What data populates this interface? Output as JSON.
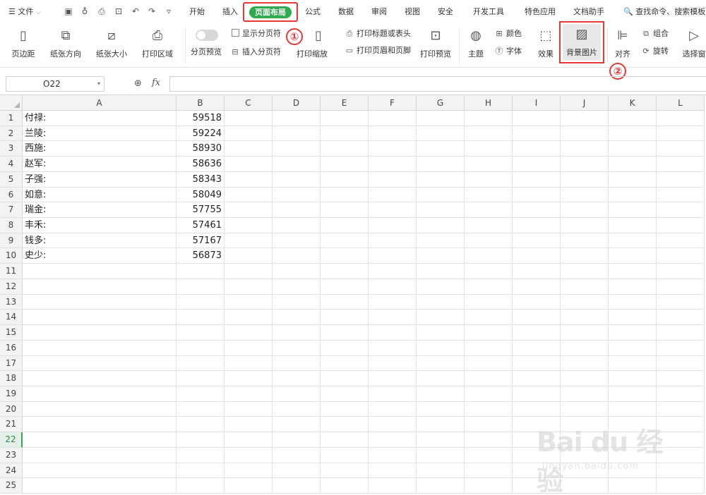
{
  "menubar": {
    "file_label": "文件",
    "tabs": [
      "开始",
      "插入",
      "页面布局",
      "公式",
      "数据",
      "审阅",
      "视图",
      "安全",
      "开发工具",
      "特色应用",
      "文档助手"
    ],
    "active_tab": "页面布局",
    "search_placeholder": "查找命令、搜索模板"
  },
  "ribbon": {
    "margins": "页边距",
    "orientation": "纸张方向",
    "size": "纸张大小",
    "print_area": "打印区域",
    "page_break_preview": "分页预览",
    "show_page_breaks": "显示分页符",
    "insert_page_break": "插入分页符",
    "print_scaling": "打印缩放",
    "print_titles": "打印标题或表头",
    "print_header_footer": "打印页眉和页脚",
    "print_preview": "打印预览",
    "theme": "主题",
    "colors": "颜色",
    "fonts": "字体",
    "effects": "效果",
    "background_picture": "背景图片",
    "align": "对齐",
    "group": "组合",
    "rotate": "旋转",
    "selection_pane": "选择窗"
  },
  "annotations": {
    "step1": "①",
    "step2": "②"
  },
  "formula_bar": {
    "name_box": "O22",
    "fx": "fx",
    "formula": ""
  },
  "columns": [
    "A",
    "B",
    "C",
    "D",
    "E",
    "F",
    "G",
    "H",
    "I",
    "J",
    "K",
    "L"
  ],
  "rows": [
    {
      "n": "1",
      "a": "付禄:",
      "b": "59518"
    },
    {
      "n": "2",
      "a": "兰陵:",
      "b": "59224"
    },
    {
      "n": "3",
      "a": "西施:",
      "b": "58930"
    },
    {
      "n": "4",
      "a": "赵军:",
      "b": "58636"
    },
    {
      "n": "5",
      "a": "子强:",
      "b": "58343"
    },
    {
      "n": "6",
      "a": "如意:",
      "b": "58049"
    },
    {
      "n": "7",
      "a": "瑞金:",
      "b": "57755"
    },
    {
      "n": "8",
      "a": "丰禾:",
      "b": "57461"
    },
    {
      "n": "9",
      "a": "钱多:",
      "b": "57167"
    },
    {
      "n": "10",
      "a": "史少:",
      "b": "56873"
    },
    {
      "n": "11",
      "a": "",
      "b": ""
    },
    {
      "n": "12",
      "a": "",
      "b": ""
    },
    {
      "n": "13",
      "a": "",
      "b": ""
    },
    {
      "n": "14",
      "a": "",
      "b": ""
    },
    {
      "n": "15",
      "a": "",
      "b": ""
    },
    {
      "n": "16",
      "a": "",
      "b": ""
    },
    {
      "n": "17",
      "a": "",
      "b": ""
    },
    {
      "n": "18",
      "a": "",
      "b": ""
    },
    {
      "n": "19",
      "a": "",
      "b": ""
    },
    {
      "n": "20",
      "a": "",
      "b": ""
    },
    {
      "n": "21",
      "a": "",
      "b": ""
    },
    {
      "n": "22",
      "a": "",
      "b": ""
    },
    {
      "n": "23",
      "a": "",
      "b": ""
    },
    {
      "n": "24",
      "a": "",
      "b": ""
    },
    {
      "n": "25",
      "a": "",
      "b": ""
    }
  ],
  "active_row": "22",
  "watermark": {
    "main": "Bai du 经验",
    "sub": "jingyan.baidu.com"
  },
  "colors": {
    "accent": "#2eaa4f",
    "highlight": "#e53935"
  }
}
